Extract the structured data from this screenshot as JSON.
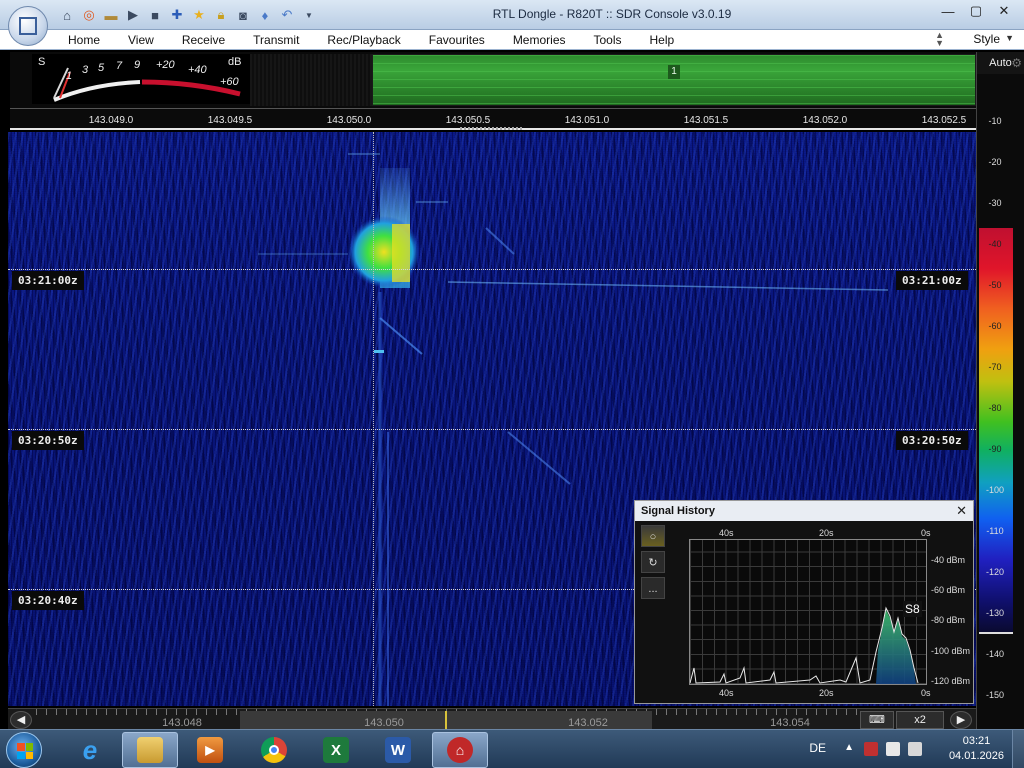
{
  "window": {
    "title": "RTL Dongle - R820T :: SDR Console v3.0.19",
    "controls": [
      "minimize-icon",
      "maximize-icon",
      "close-icon"
    ]
  },
  "quick_access": [
    "home-icon",
    "lifebuoy-icon",
    "folder-icon",
    "play-icon",
    "stop-icon",
    "add-icon",
    "star-icon",
    "lock-icon",
    "camera-icon",
    "drop-icon",
    "undo-icon",
    "dropdown-icon"
  ],
  "menu": {
    "items": [
      "Home",
      "View",
      "Receive",
      "Transmit",
      "Rec/Playback",
      "Favourites",
      "Memories",
      "Tools",
      "Help"
    ],
    "style_label": "Style"
  },
  "smeter": {
    "s_label": "S",
    "db_label": "dB",
    "scale": [
      "1",
      "3",
      "5",
      "7",
      "9",
      "+20",
      "+40",
      "+60"
    ]
  },
  "spectrum": {
    "marker_label": "1"
  },
  "frequency_ruler": [
    "143.049.0",
    "143.049.5",
    "143.050.0",
    "143.050.5",
    "143.051.0",
    "143.051.5",
    "143.052.0",
    "143.052.5"
  ],
  "waterfall": {
    "time_markers": [
      "03:21:00z",
      "03:20:50z",
      "03:20:40z"
    ]
  },
  "signal_history": {
    "title": "Signal History",
    "top_axis": [
      "40s",
      "20s",
      "0s"
    ],
    "bottom_axis": [
      "40s",
      "20s",
      "0s"
    ],
    "y_axis": [
      "-40 dBm",
      "-60 dBm",
      "-80 dBm",
      "-100 dBm",
      "-120 dBm"
    ],
    "s_reading": "S8",
    "side_buttons": [
      "○",
      "↻",
      "..."
    ]
  },
  "right_scale": {
    "auto_label": "Auto",
    "labels": [
      "-10",
      "-20",
      "-30",
      "-40",
      "-50",
      "-60",
      "-70",
      "-80",
      "-90",
      "-100",
      "-110",
      "-120",
      "-130",
      "-140",
      "-150"
    ]
  },
  "bottom_strip": {
    "freqs": [
      "143.048",
      "143.050",
      "143.052",
      "143.054"
    ],
    "zoom_label": "x2"
  },
  "taskbar": {
    "apps": [
      "internet-explorer-icon",
      "file-explorer-icon",
      "media-player-icon",
      "chrome-icon",
      "excel-icon",
      "word-icon",
      "sdr-console-icon"
    ],
    "language": "DE",
    "time": "03:21",
    "date": "04.01.2026"
  },
  "colors": {
    "waterfall_bg": "#08157a",
    "spectrum_green": "#3aa63a",
    "meter_red": "#c8102e",
    "taskbar": "#2b4868"
  }
}
